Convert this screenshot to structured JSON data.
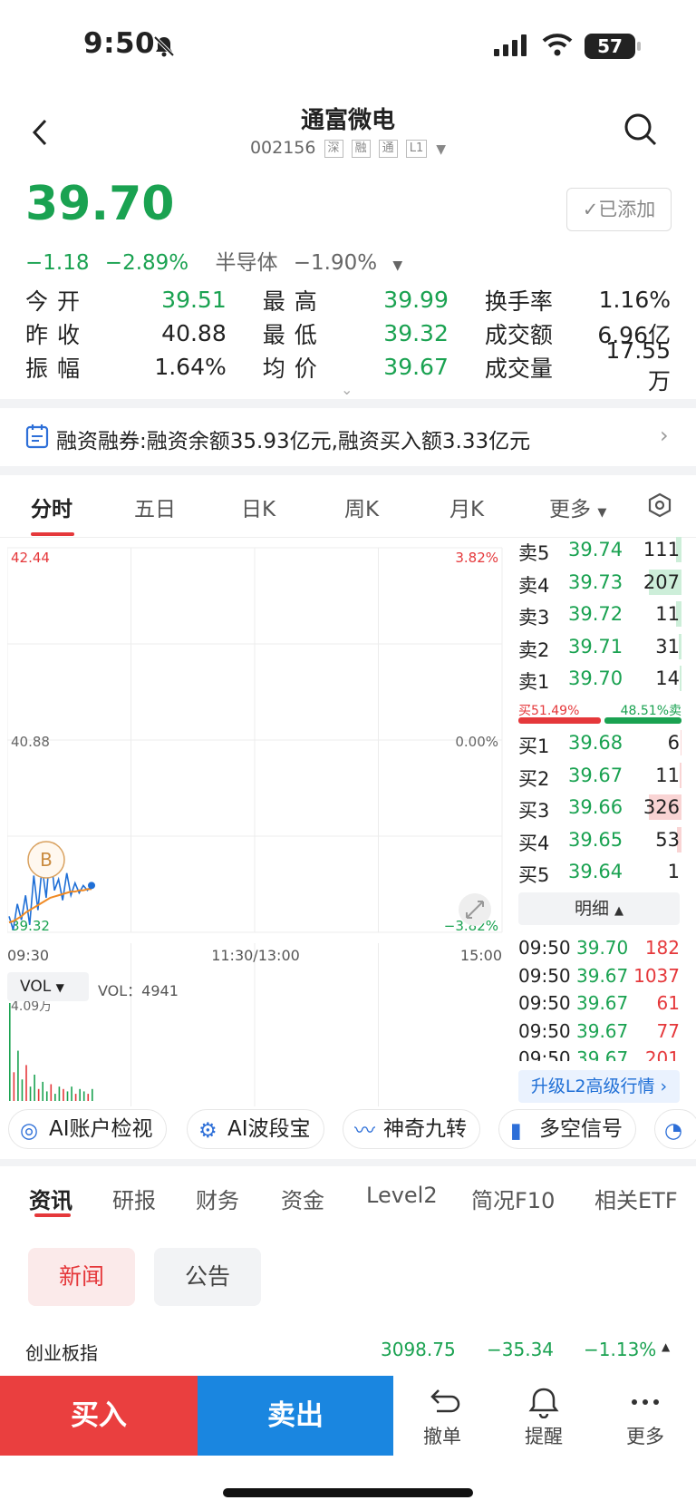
{
  "status_bar": {
    "time": "9:50",
    "battery": "57"
  },
  "header": {
    "title": "通富微电",
    "code": "002156",
    "tags": [
      "深",
      "融",
      "通",
      "L1"
    ]
  },
  "quote": {
    "price": "39.70",
    "change": "−1.18",
    "change_pct": "−2.89%",
    "sector": "半导体",
    "sector_pct": "−1.90%",
    "added_label": "已添加"
  },
  "stats": {
    "open_label": "今开",
    "open": "39.51",
    "high_label": "最高",
    "high": "39.99",
    "turnover_rate_label": "换手率",
    "turnover_rate": "1.16%",
    "prev_close_label": "昨收",
    "prev_close": "40.88",
    "low_label": "最低",
    "low": "39.32",
    "amount_label": "成交额",
    "amount": "6.96亿",
    "amplitude_label": "振幅",
    "amplitude": "1.64%",
    "avg_label": "均价",
    "avg": "39.67",
    "volume_label": "成交量",
    "volume": "17.55万"
  },
  "margin_banner": {
    "text": "融资融券:融资余额35.93亿元,融资买入额3.33亿元"
  },
  "chart_tabs": [
    "分时",
    "五日",
    "日K",
    "周K",
    "月K",
    "更多"
  ],
  "chart": {
    "top_price": "42.44",
    "top_pct": "3.82%",
    "mid_price": "40.88",
    "mid_pct": "0.00%",
    "low_price": "39.32",
    "low_pct": "−3.82%",
    "time_start": "09:30",
    "time_mid": "11:30/13:00",
    "time_end": "15:00",
    "marker": "B",
    "vol_selector": "VOL",
    "vol_readout": "VOL：4941",
    "vol_max": "4.09万"
  },
  "chart_data": {
    "type": "line",
    "title": "",
    "ylim": [
      39.32,
      42.44
    ],
    "x": [
      "09:30",
      "09:31",
      "09:32",
      "09:33",
      "09:34",
      "09:35",
      "09:36",
      "09:37",
      "09:38",
      "09:39",
      "09:40",
      "09:41",
      "09:42",
      "09:43",
      "09:44",
      "09:45",
      "09:46",
      "09:47",
      "09:48",
      "09:49",
      "09:50"
    ],
    "series": [
      {
        "values": [
          39.45,
          39.34,
          39.55,
          39.42,
          39.62,
          39.38,
          39.78,
          39.5,
          39.85,
          39.6,
          39.99,
          39.66,
          39.75,
          39.58,
          39.8,
          39.62,
          39.72,
          39.64,
          39.7,
          39.66,
          39.7
        ]
      },
      {
        "values": [
          39.4,
          39.41,
          39.43,
          39.45,
          39.48,
          39.5,
          39.52,
          39.54,
          39.56,
          39.58,
          39.6,
          39.61,
          39.62,
          39.63,
          39.64,
          39.65,
          39.65,
          39.66,
          39.66,
          39.67,
          39.67
        ]
      }
    ],
    "volume": [
      4.09,
      1.2,
      2.1,
      0.9,
      1.5,
      0.6,
      1.1,
      0.5,
      0.8,
      0.4,
      0.7,
      0.3,
      0.6,
      0.5,
      0.4,
      0.6,
      0.3,
      0.5,
      0.4,
      0.3,
      0.5
    ]
  },
  "order_book": {
    "asks": [
      {
        "label": "卖5",
        "price": "39.74",
        "vol": "111",
        "frac": 0.1
      },
      {
        "label": "卖4",
        "price": "39.73",
        "vol": "207",
        "frac": 0.6
      },
      {
        "label": "卖3",
        "price": "39.72",
        "vol": "11",
        "frac": 0.1
      },
      {
        "label": "卖2",
        "price": "39.71",
        "vol": "31",
        "frac": 0.05
      },
      {
        "label": "卖1",
        "price": "39.70",
        "vol": "14",
        "frac": 0.03
      }
    ],
    "buy_ratio": "买51.49%",
    "sell_ratio": "48.51%卖",
    "bids": [
      {
        "label": "买1",
        "price": "39.68",
        "vol": "6",
        "frac": 0.02
      },
      {
        "label": "买2",
        "price": "39.67",
        "vol": "11",
        "frac": 0.03
      },
      {
        "label": "买3",
        "price": "39.66",
        "vol": "326",
        "frac": 0.6
      },
      {
        "label": "买4",
        "price": "39.65",
        "vol": "53",
        "frac": 0.08
      },
      {
        "label": "买5",
        "price": "39.64",
        "vol": "1",
        "frac": 0.0
      }
    ],
    "detail_label": "明细",
    "ticks": [
      {
        "time": "09:50",
        "price": "39.70",
        "vol": "182"
      },
      {
        "time": "09:50",
        "price": "39.67",
        "vol": "1037"
      },
      {
        "time": "09:50",
        "price": "39.67",
        "vol": "61"
      },
      {
        "time": "09:50",
        "price": "39.67",
        "vol": "77"
      },
      {
        "time": "09:50",
        "price": "39.67",
        "vol": "201"
      }
    ],
    "upgrade_label": "升级L2高级行情"
  },
  "tools": [
    "AI账户检视",
    "AI波段宝",
    "神奇九转",
    "多空信号"
  ],
  "news_tabs": [
    "资讯",
    "研报",
    "财务",
    "资金",
    "Level2",
    "简况F10",
    "相关ETF"
  ],
  "news_pills": {
    "news": "新闻",
    "announcement": "公告"
  },
  "index_row": {
    "name": "创业板指",
    "value": "3098.75",
    "change": "−35.34",
    "pct": "−1.13%"
  },
  "bottom_bar": {
    "buy": "买入",
    "sell": "卖出",
    "cancel": "撤单",
    "alert": "提醒",
    "more": "更多"
  },
  "colors": {
    "up": "#e5383b",
    "down": "#1aa251",
    "buy_button": "#ea3f3f",
    "sell_button": "#1a86e0"
  }
}
